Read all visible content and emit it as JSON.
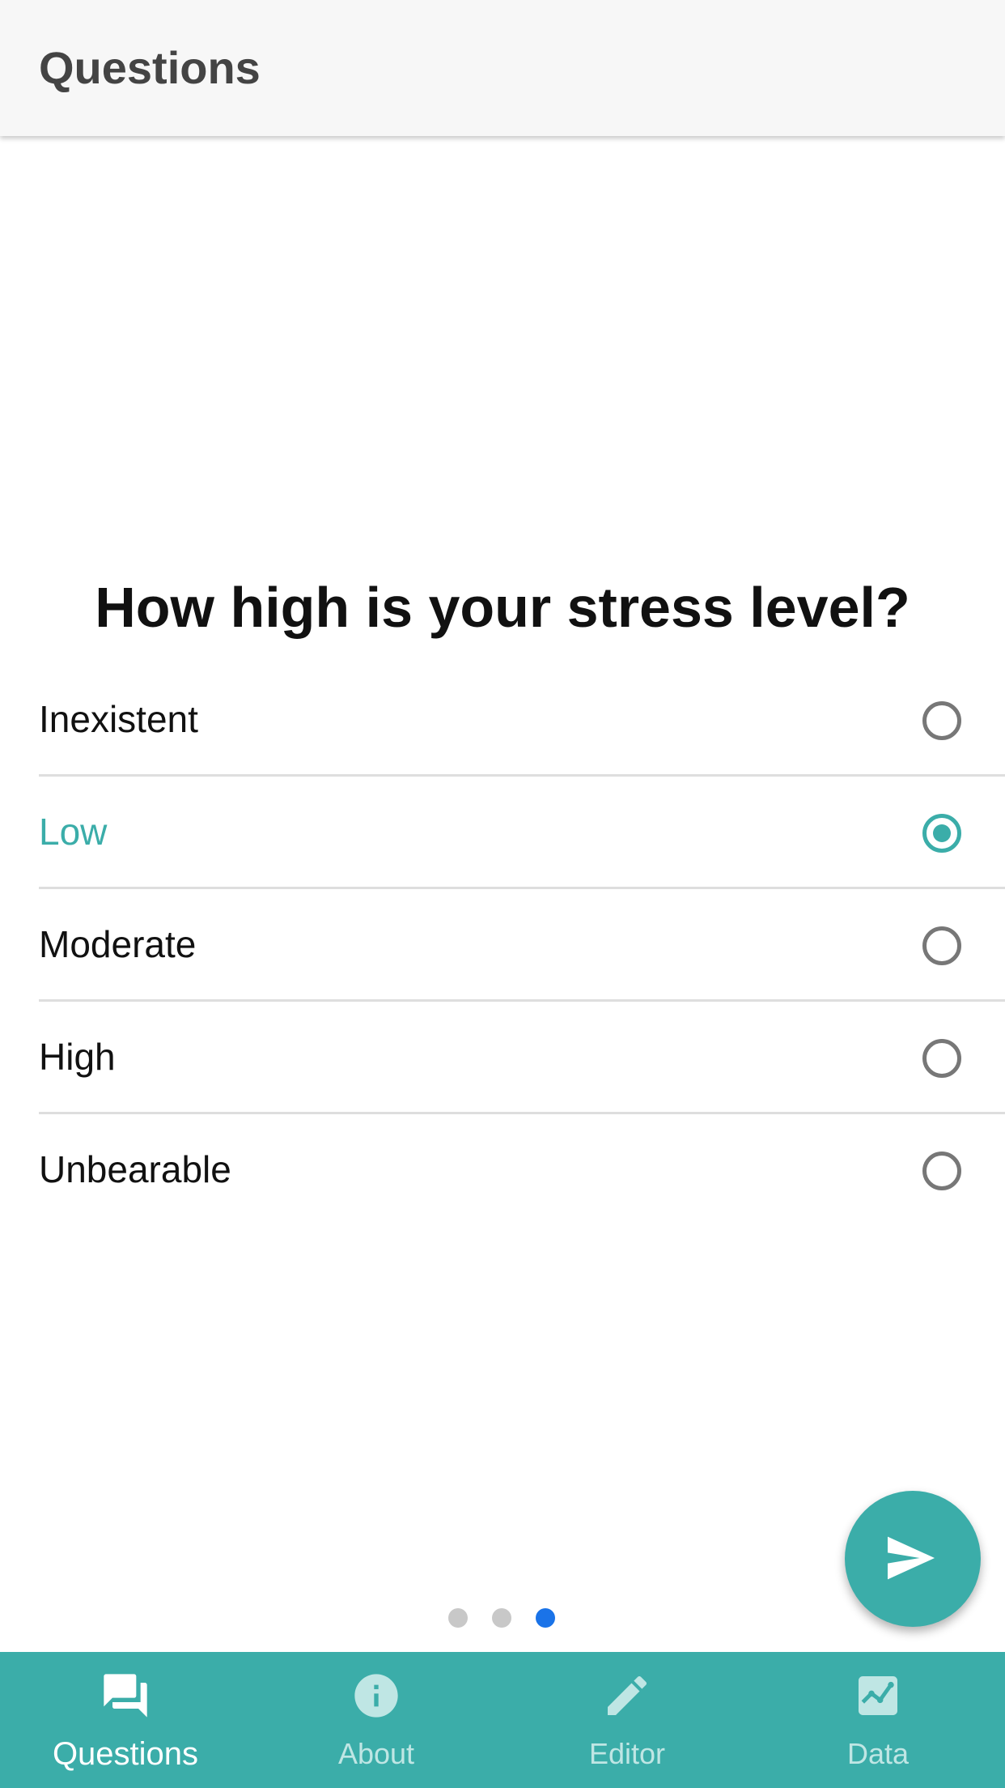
{
  "header": {
    "title": "Questions"
  },
  "question": {
    "text": "How high is your stress level?",
    "options": [
      {
        "label": "Inexistent",
        "selected": false
      },
      {
        "label": "Low",
        "selected": true
      },
      {
        "label": "Moderate",
        "selected": false
      },
      {
        "label": "High",
        "selected": false
      },
      {
        "label": "Unbearable",
        "selected": false
      }
    ]
  },
  "fab": {
    "icon": "send-icon"
  },
  "pager": {
    "total_pages": 3,
    "current_page": 3
  },
  "bottom_nav": {
    "items": [
      {
        "label": "Questions",
        "icon": "chat-icon",
        "active": true
      },
      {
        "label": "About",
        "icon": "info-icon",
        "active": false
      },
      {
        "label": "Editor",
        "icon": "pencil-icon",
        "active": false
      },
      {
        "label": "Data",
        "icon": "chart-icon",
        "active": false
      }
    ]
  },
  "colors": {
    "accent": "#3bada9",
    "header_background": "#f7f7f7",
    "active_dot": "#1a73e8",
    "inactive_dot": "#c8c8c8"
  }
}
